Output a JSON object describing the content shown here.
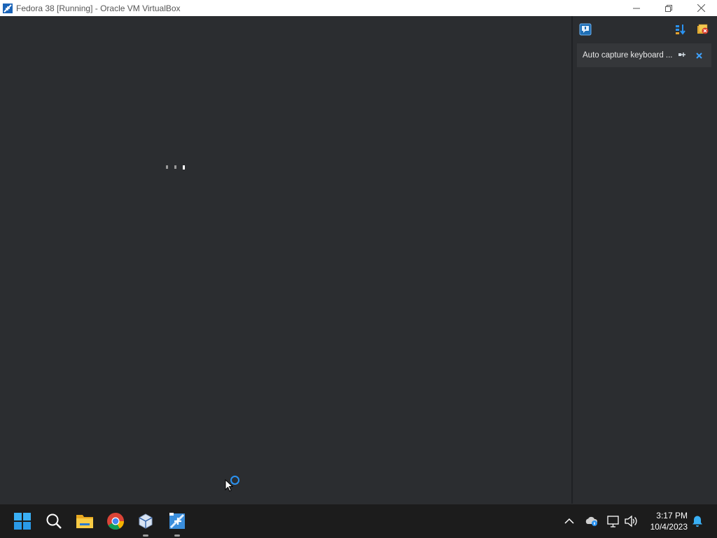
{
  "window": {
    "title": "Fedora 38 [Running] - Oracle VM VirtualBox",
    "icon": "virtualbox-vm-icon",
    "controls": [
      "minimize-icon",
      "restore-icon",
      "close-icon"
    ]
  },
  "vm_screen": {
    "loading_dots": 3,
    "active_dot_index": 2
  },
  "notification_panel": {
    "toggle_icon": "notification-center-icon",
    "sort_icon": "sort-icon",
    "dismiss_all_icon": "dismiss-all-icon",
    "items": [
      {
        "text": "Auto capture keyboard ...",
        "pin_icon": "pin-icon",
        "close_icon": "close-icon"
      }
    ]
  },
  "taskbar": {
    "pinned": [
      {
        "name": "start-button",
        "icon": "windows-logo-icon"
      },
      {
        "name": "search-button",
        "icon": "search-icon"
      },
      {
        "name": "file-explorer-button",
        "icon": "folder-icon"
      },
      {
        "name": "chrome-button",
        "icon": "chrome-icon"
      },
      {
        "name": "virtualbox-manager-button",
        "icon": "virtualbox-icon",
        "running": true
      },
      {
        "name": "fedora-vm-button",
        "icon": "fedora-vm-icon",
        "running": true
      }
    ],
    "tray": {
      "icons": [
        "chevron-up-icon",
        "onedrive-icon",
        "network-icon",
        "volume-icon"
      ],
      "time": "3:17 PM",
      "date": "10/4/2023",
      "notification_icon": "bell-icon"
    }
  },
  "colors": {
    "background": "#2b2d30",
    "taskbar": "#1c1c1c",
    "accent": "#2a93f2"
  }
}
